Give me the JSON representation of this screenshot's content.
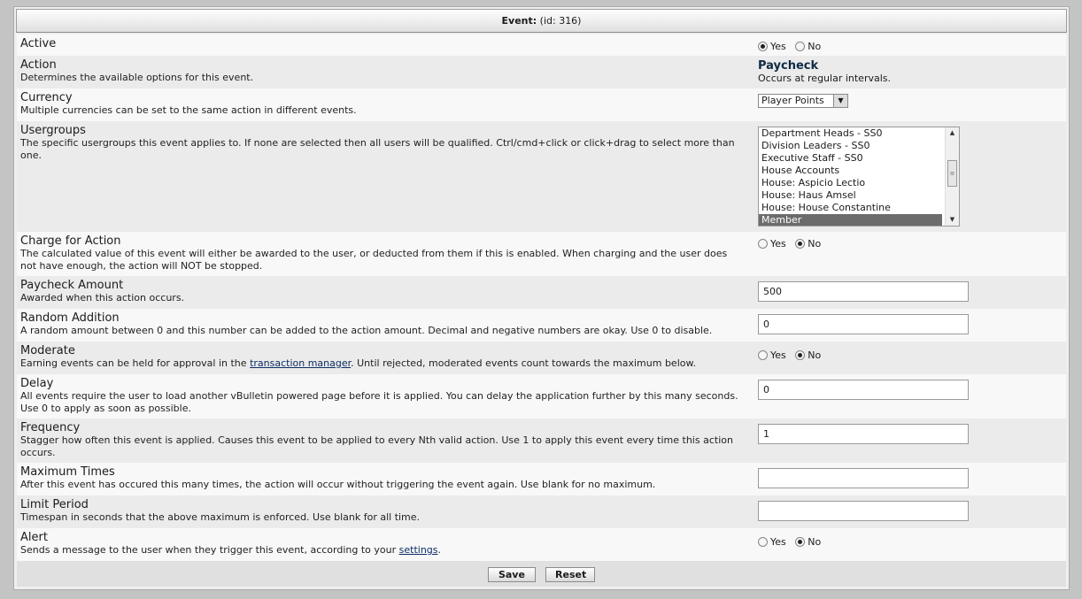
{
  "header": {
    "title": "Event:",
    "id_text": "(id: 316)"
  },
  "rows": {
    "active": {
      "label": "Active",
      "yes": "Yes",
      "no": "No",
      "selected": "yes"
    },
    "action": {
      "label": "Action",
      "desc": "Determines the available options for this event.",
      "value": "Paycheck",
      "value_desc": "Occurs at regular intervals."
    },
    "currency": {
      "label": "Currency",
      "desc": "Multiple currencies can be set to the same action in different events.",
      "selected": "Player Points"
    },
    "usergroups": {
      "label": "Usergroups",
      "desc": "The specific usergroups this event applies to. If none are selected then all users will be qualified. Ctrl/cmd+click or click+drag to select more than one.",
      "options": [
        "Department Heads - SS0",
        "Division Leaders - SS0",
        "Executive Staff - SS0",
        "House Accounts",
        "House: Aspicio Lectio",
        "House: Haus Amsel",
        "House: House Constantine",
        "Member"
      ],
      "selected": "Member"
    },
    "charge": {
      "label": "Charge for Action",
      "desc": "The calculated value of this event will either be awarded to the user, or deducted from them if this is enabled. When charging and the user does not have enough, the action will NOT be stopped.",
      "yes": "Yes",
      "no": "No",
      "selected": "no"
    },
    "paycheck_amount": {
      "label": "Paycheck Amount",
      "desc": "Awarded when this action occurs.",
      "value": "500"
    },
    "random_addition": {
      "label": "Random Addition",
      "desc": "A random amount between 0 and this number can be added to the action amount. Decimal and negative numbers are okay. Use 0 to disable.",
      "value": "0"
    },
    "moderate": {
      "label": "Moderate",
      "desc_pre": "Earning events can be held for approval in the ",
      "desc_link": "transaction manager",
      "desc_post": ". Until rejected, moderated events count towards the maximum below.",
      "yes": "Yes",
      "no": "No",
      "selected": "no"
    },
    "delay": {
      "label": "Delay",
      "desc": "All events require the user to load another vBulletin powered page before it is applied. You can delay the application further by this many seconds. Use 0 to apply as soon as possible.",
      "value": "0"
    },
    "frequency": {
      "label": "Frequency",
      "desc": "Stagger how often this event is applied. Causes this event to be applied to every Nth valid action. Use 1 to apply this event every time this action occurs.",
      "value": "1"
    },
    "maximum_times": {
      "label": "Maximum Times",
      "desc": "After this event has occured this many times, the action will occur without triggering the event again. Use blank for no maximum.",
      "value": ""
    },
    "limit_period": {
      "label": "Limit Period",
      "desc": "Timespan in seconds that the above maximum is enforced. Use blank for all time.",
      "value": ""
    },
    "alert": {
      "label": "Alert",
      "desc_pre": "Sends a message to the user when they trigger this event, according to your ",
      "desc_link": "settings",
      "desc_post": ".",
      "yes": "Yes",
      "no": "No",
      "selected": "no"
    }
  },
  "footer": {
    "save": "Save",
    "reset": "Reset"
  }
}
